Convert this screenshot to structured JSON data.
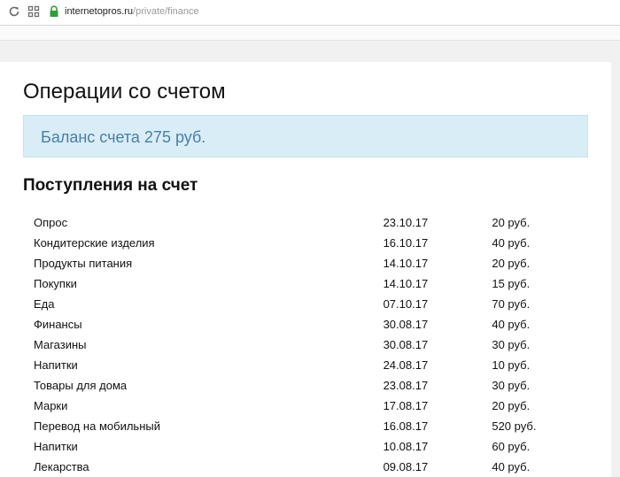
{
  "browser": {
    "url_domain": "internetopros.ru",
    "url_path": "/private/finance"
  },
  "page": {
    "title": "Операции со счетом",
    "balance_text": "Баланс счета 275 руб.",
    "section_title": "Поступления на счет"
  },
  "transactions": [
    {
      "name": "Опрос",
      "date": "23.10.17",
      "amount": "20 руб."
    },
    {
      "name": "Кондитерские изделия",
      "date": "16.10.17",
      "amount": "40 руб."
    },
    {
      "name": "Продукты питания",
      "date": "14.10.17",
      "amount": "20 руб."
    },
    {
      "name": "Покупки",
      "date": "14.10.17",
      "amount": "15 руб."
    },
    {
      "name": "Еда",
      "date": "07.10.17",
      "amount": "70 руб."
    },
    {
      "name": "Финансы",
      "date": "30.08.17",
      "amount": "40 руб."
    },
    {
      "name": "Магазины",
      "date": "30.08.17",
      "amount": "30 руб."
    },
    {
      "name": "Напитки",
      "date": "24.08.17",
      "amount": "10 руб."
    },
    {
      "name": "Товары для дома",
      "date": "23.08.17",
      "amount": "30 руб."
    },
    {
      "name": "Марки",
      "date": "17.08.17",
      "amount": "20 руб."
    },
    {
      "name": "Перевод на мобильный",
      "date": "16.08.17",
      "amount": "520 руб."
    },
    {
      "name": "Напитки",
      "date": "10.08.17",
      "amount": "60 руб."
    },
    {
      "name": "Лекарства",
      "date": "09.08.17",
      "amount": "40 руб."
    }
  ],
  "icons": {
    "reload": "reload-icon",
    "apps": "apps-icon",
    "lock": "lock-icon"
  },
  "colors": {
    "balance_bg": "#d9edf7",
    "balance_text": "#4a7ea8",
    "lock": "#2e9e3a"
  }
}
